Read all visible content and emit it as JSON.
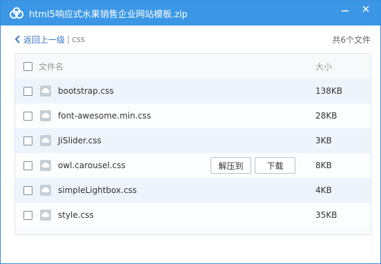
{
  "window": {
    "title": "html5响应式水果销售企业网站模板.zip",
    "app_icon": "cloud-icon"
  },
  "nav": {
    "back_label": "返回上一级",
    "separator": "|",
    "current_folder": "css",
    "file_count": "共6个文件"
  },
  "table": {
    "header": {
      "name": "文件名",
      "size": "大小"
    },
    "rows": [
      {
        "name": "bootstrap.css",
        "size": "138KB"
      },
      {
        "name": "font-awesome.min.css",
        "size": "28KB"
      },
      {
        "name": "JiSlider.css",
        "size": "3KB"
      },
      {
        "name": "owl.carousel.css",
        "size": "8KB"
      },
      {
        "name": "simpleLightbox.css",
        "size": "4KB"
      },
      {
        "name": "style.css",
        "size": "35KB"
      }
    ],
    "actions": {
      "extract": "解压到",
      "download": "下载"
    }
  },
  "colors": {
    "titlebar": "#3b97e6",
    "link": "#3a75c4",
    "row_highlight": "#eef4fb"
  }
}
